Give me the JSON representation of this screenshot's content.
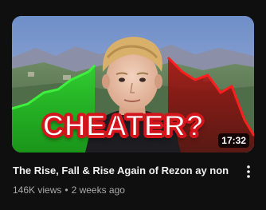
{
  "video": {
    "title": "The Rise, Fall & Rise Again of Rezon ay non",
    "views": "146K views",
    "separator": "•",
    "age": "2 weeks ago",
    "duration": "17:32",
    "thumbnail_text": "CHEATER?"
  },
  "colors": {
    "background": "#0f0f0f",
    "title_text": "#f1f1f1",
    "meta_text": "#aaaaaa",
    "thumbnail_text_fill": "#ffffff",
    "thumbnail_text_outline": "#d4151c",
    "rise_line": "#27d627",
    "fall_line": "#e3161b"
  },
  "icons": {
    "menu": "vertical-dots-icon"
  }
}
